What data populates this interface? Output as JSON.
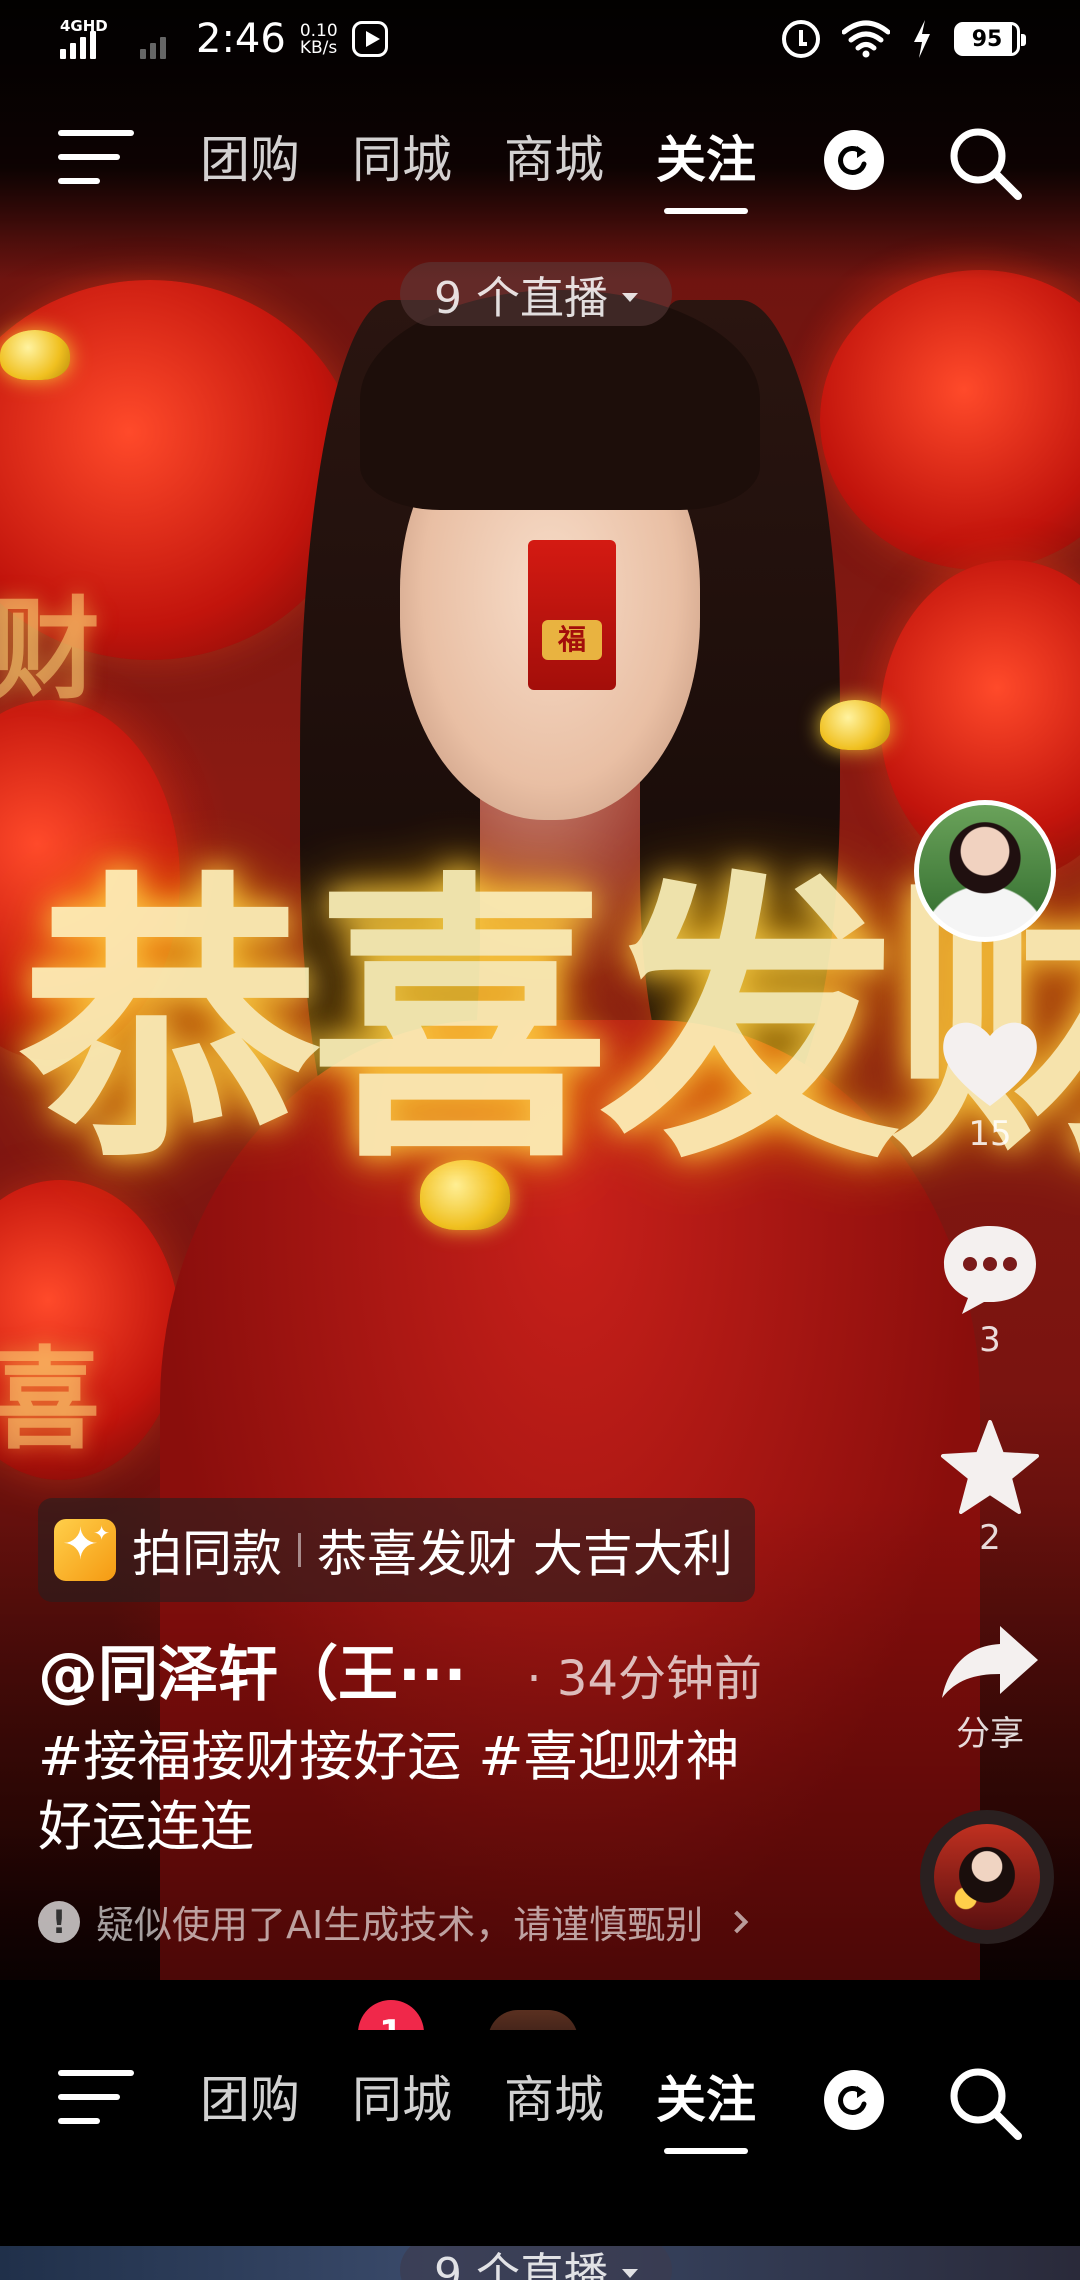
{
  "status_bar": {
    "network": "4GHD",
    "time": "2:46",
    "speed_value": "0.10",
    "speed_unit": "KB/s",
    "battery": "95"
  },
  "nav": {
    "tabs": [
      {
        "label": "团购"
      },
      {
        "label": "同城"
      },
      {
        "label": "商城"
      },
      {
        "label": "关注",
        "active": true
      }
    ],
    "icons": [
      "menu-icon",
      "refresh-icon",
      "search-icon"
    ]
  },
  "live_pill": {
    "label": "9 个直播"
  },
  "video": {
    "overlay_text": "恭喜发财"
  },
  "rail": {
    "like_count": "15",
    "comment_count": "3",
    "favorite_count": "2",
    "share_label": "分享"
  },
  "caption": {
    "same_style_label": "拍同款",
    "template_name": "恭喜发财 大吉大利",
    "author": "@同泽轩（王···",
    "post_time": "· 34分钟前",
    "description_line1": "#接福接财接好运 #喜迎财神",
    "description_line2": "好运连连",
    "ai_warning": "疑似使用了AI生成技术，请谨慎甄别"
  },
  "bottom_preview": {
    "badge_count": "1",
    "nav_tabs": [
      "团购",
      "同城",
      "商城",
      "关注"
    ],
    "live_pill": "9 个直播"
  },
  "colors": {
    "badge": "#f0284a",
    "sparkle": "#ffcf4a"
  }
}
